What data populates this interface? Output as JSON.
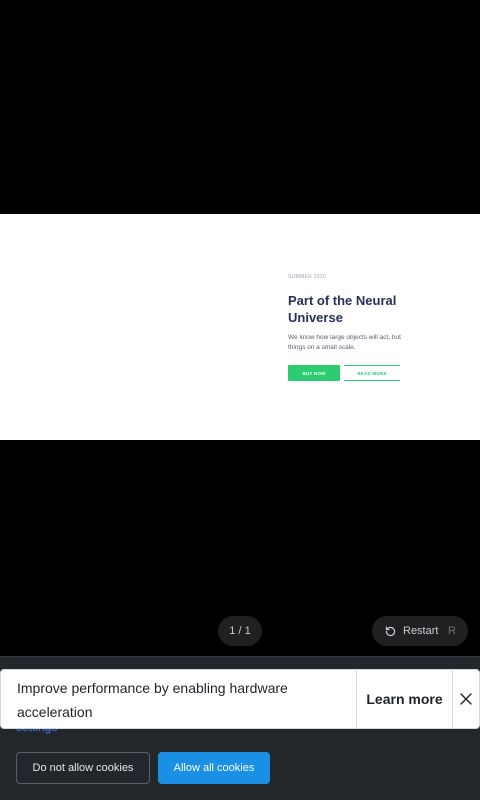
{
  "slide": {
    "eyebrow": "SUMMER 2020",
    "headline": "Part of the Neural Universe",
    "body": "We know how large objects will act, but things on a small scale.",
    "buy_label": "BUY NOW",
    "read_label": "READ MORE"
  },
  "player": {
    "page_indicator": "1 / 1",
    "restart_label": "Restart",
    "restart_key": "R"
  },
  "toast": {
    "message": "Improve performance by enabling hardware acceleration",
    "learn_label": "Learn more"
  },
  "cookies": {
    "settings_link": "settings",
    "deny_label": "Do not allow cookies",
    "allow_label": "Allow all cookies"
  },
  "colors": {
    "accent_green": "#2ecc71",
    "headline_navy": "#2a2f5a",
    "allow_blue": "#1a8fe6",
    "link_blue": "#3b82f6"
  },
  "icons": {
    "restart": "restart-icon",
    "close": "close-icon"
  }
}
